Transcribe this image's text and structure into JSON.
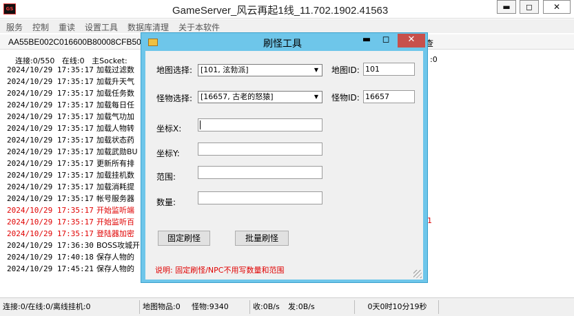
{
  "window": {
    "title": "GameServer_风云再起1线_11.702.1902.41563",
    "minimize": "▬",
    "maximize": "◻",
    "close": "✕",
    "icon": "app-logo-icon"
  },
  "menu": [
    "服务",
    "控制",
    "重读",
    "设置工具",
    "数据库清理",
    "关于本软件"
  ],
  "tab": {
    "label": "AA55BE002C016600B80008CFB50",
    "right": "查"
  },
  "status_line": {
    "connections": "连接:0/550",
    "online": "在线:0",
    "socket": "主Socket:",
    "right": ":0"
  },
  "log": [
    {
      "ts": "2024/10/29 17:35:17",
      "msg": "加载过滤数",
      "red": false
    },
    {
      "ts": "2024/10/29 17:35:17",
      "msg": "加载升天气",
      "red": false
    },
    {
      "ts": "2024/10/29 17:35:17",
      "msg": "加载任务数",
      "red": false
    },
    {
      "ts": "2024/10/29 17:35:17",
      "msg": "加载每日任",
      "red": false
    },
    {
      "ts": "2024/10/29 17:35:17",
      "msg": "加载气功加",
      "red": false
    },
    {
      "ts": "2024/10/29 17:35:17",
      "msg": "加载人物转",
      "red": false
    },
    {
      "ts": "2024/10/29 17:35:17",
      "msg": "加载状态药",
      "red": false
    },
    {
      "ts": "2024/10/29 17:35:17",
      "msg": "加载武勋BU",
      "red": false
    },
    {
      "ts": "2024/10/29 17:35:17",
      "msg": "更新所有排",
      "red": false
    },
    {
      "ts": "2024/10/29 17:35:17",
      "msg": "加载挂机数",
      "red": false
    },
    {
      "ts": "2024/10/29 17:35:17",
      "msg": "加载消耗提",
      "red": false
    },
    {
      "ts": "2024/10/29 17:35:17",
      "msg": "帐号服务器",
      "red": false
    },
    {
      "ts": "2024/10/29 17:35:17",
      "msg": "开始监听端",
      "red": true
    },
    {
      "ts": "2024/10/29 17:35:17",
      "msg": "开始监听百",
      "red": true
    },
    {
      "ts": "2024/10/29 17:35:17",
      "msg": "登陆器加密",
      "red": true
    },
    {
      "ts": "2024/10/29 17:36:30",
      "msg": "BOSS攻城开",
      "red": false
    },
    {
      "ts": "2024/10/29 17:40:18",
      "msg": "保存人物的",
      "red": false
    },
    {
      "ts": "2024/10/29 17:45:21",
      "msg": "保存人物的",
      "red": false
    }
  ],
  "log_right_mark": "1",
  "statusbar": {
    "conn": "连接:0/在线:0/离线挂机:0",
    "map_items": "地图物品:0",
    "monsters": "怪物:9340",
    "recv": "收:0B/s",
    "send": "发:0B/s",
    "uptime": "0天0时10分19秒"
  },
  "dialog": {
    "title": "刷怪工具",
    "map_label": "地图选择:",
    "map_value": "[101, 泫勃派]",
    "map_id_label": "地图ID:",
    "map_id_value": "101",
    "monster_label": "怪物选择:",
    "monster_value": "[16657, 古老的怒猿]",
    "monster_id_label": "怪物ID:",
    "monster_id_value": "16657",
    "x_label": "坐标X:",
    "x_value": "",
    "y_label": "坐标Y:",
    "y_value": "",
    "range_label": "范围:",
    "range_value": "",
    "count_label": "数量:",
    "count_value": "",
    "fixed_button": "固定刷怪",
    "batch_button": "批量刷怪",
    "note": "说明: 固定刷怪/NPC不用写数量和范围",
    "minimize": "▬",
    "maximize": "◻",
    "close": "✕"
  }
}
